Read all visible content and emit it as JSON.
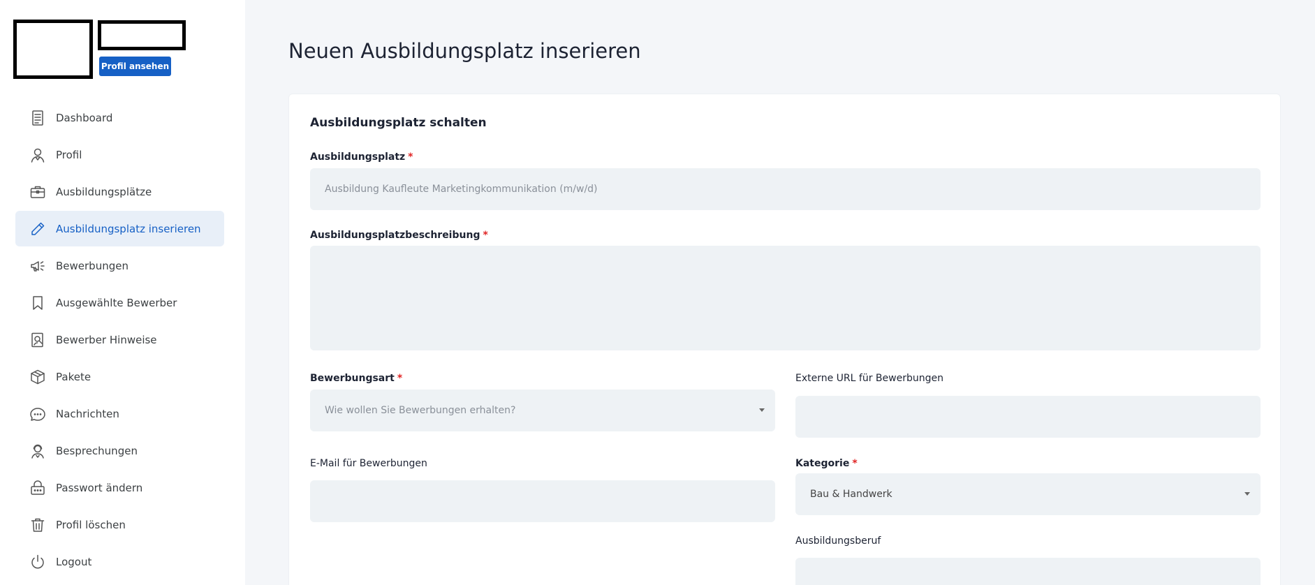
{
  "sidebar": {
    "profile_button": "Profil ansehen",
    "items": [
      {
        "label": "Dashboard",
        "icon": "document-icon"
      },
      {
        "label": "Profil",
        "icon": "user-icon"
      },
      {
        "label": "Ausbildungsplätze",
        "icon": "briefcase-icon"
      },
      {
        "label": "Ausbildungsplatz inserieren",
        "icon": "pencil-icon",
        "active": true
      },
      {
        "label": "Bewerbungen",
        "icon": "megaphone-icon"
      },
      {
        "label": "Ausgewählte Bewerber",
        "icon": "bookmark-icon"
      },
      {
        "label": "Bewerber Hinweise",
        "icon": "search-user-icon"
      },
      {
        "label": "Pakete",
        "icon": "package-icon"
      },
      {
        "label": "Nachrichten",
        "icon": "chat-icon"
      },
      {
        "label": "Besprechungen",
        "icon": "support-agent-icon"
      },
      {
        "label": "Passwort ändern",
        "icon": "lock-icon"
      },
      {
        "label": "Profil löschen",
        "icon": "trash-icon"
      },
      {
        "label": "Logout",
        "icon": "power-icon"
      }
    ]
  },
  "main": {
    "page_title": "Neuen Ausbildungsplatz inserieren",
    "card_title": "Ausbildungsplatz schalten",
    "fields": {
      "ausbildungsplatz": {
        "label": "Ausbildungsplatz",
        "required": "*",
        "placeholder": "Ausbildung Kaufleute Marketingkommunikation (m/w/d)"
      },
      "beschreibung": {
        "label": "Ausbildungsplatzbeschreibung",
        "required": "*"
      },
      "bewerbungsart": {
        "label": "Bewerbungsart",
        "required": "*",
        "placeholder": "Wie wollen Sie Bewerbungen erhalten?"
      },
      "externe_url": {
        "label": "Externe URL für Bewerbungen"
      },
      "email": {
        "label": "E-Mail für Bewerbungen"
      },
      "kategorie": {
        "label": "Kategorie",
        "required": "*",
        "value": "Bau & Handwerk"
      },
      "ausbildungsberuf": {
        "label": "Ausbildungsberuf"
      }
    }
  },
  "colors": {
    "accent": "#1660c5",
    "active_bg": "#e8eff8",
    "input_bg": "#eef2f5",
    "required": "#e02424"
  }
}
